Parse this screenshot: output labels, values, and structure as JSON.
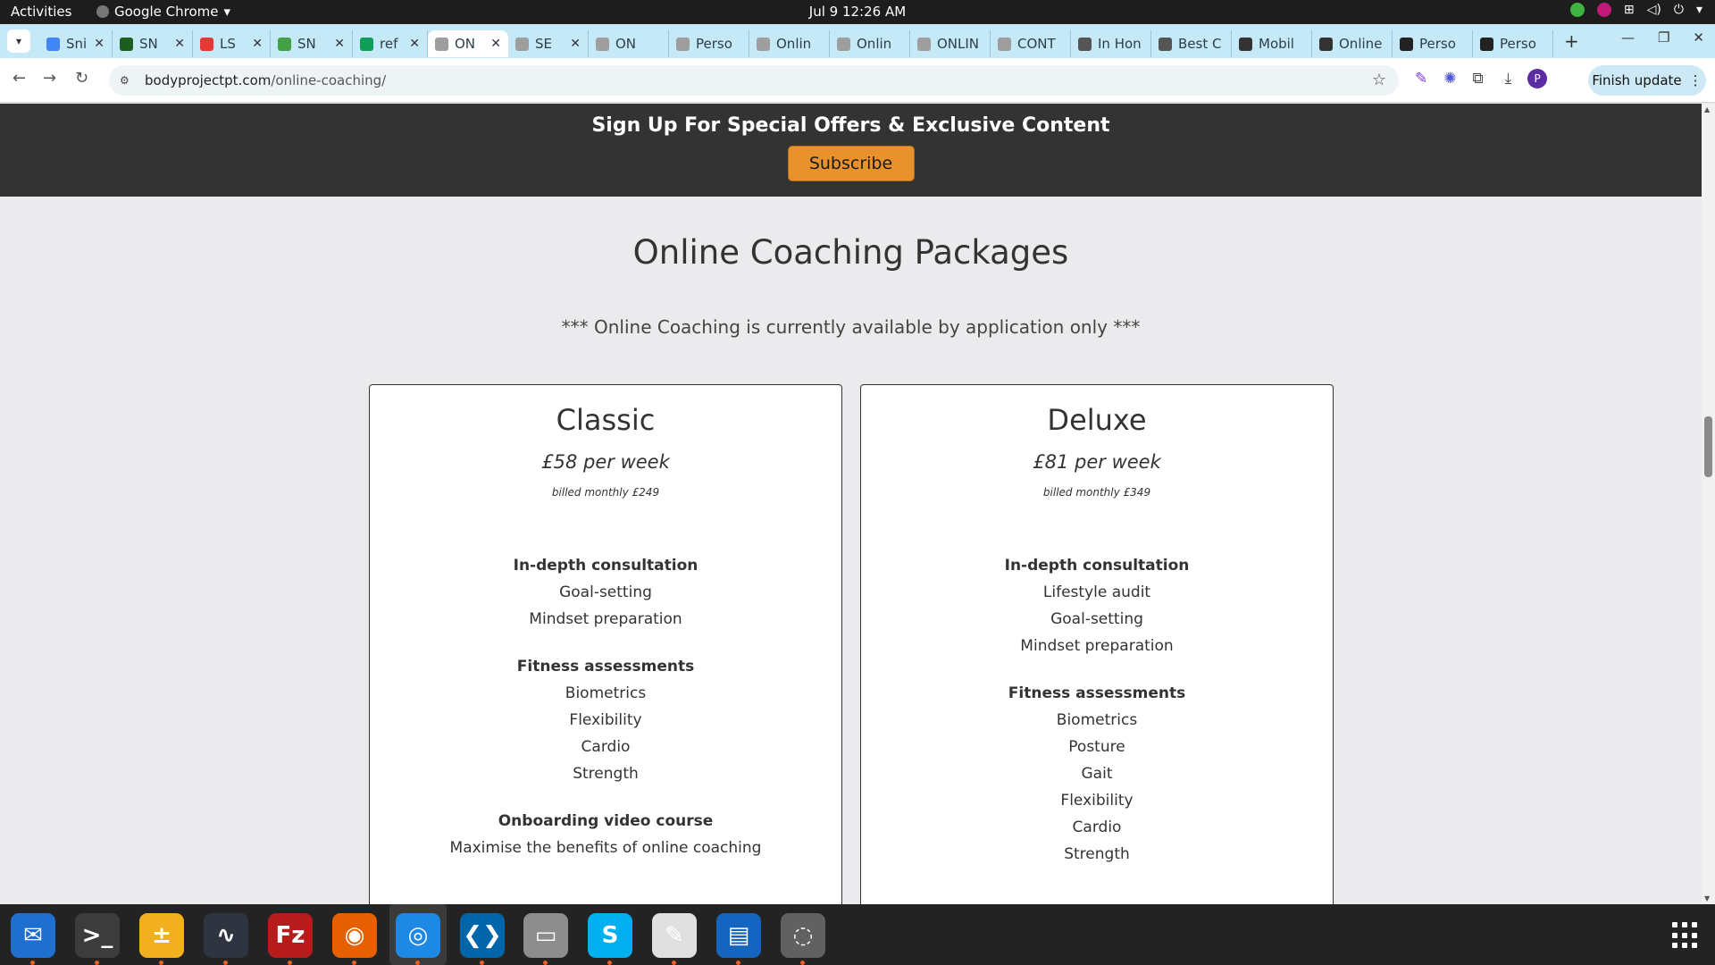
{
  "system": {
    "activities": "Activities",
    "app_name": "Google Chrome",
    "clock": "Jul 9  12:26 AM"
  },
  "tabs": [
    {
      "label": "Sni",
      "color": "#4285f4"
    },
    {
      "label": "SN",
      "color": "#1b5e20"
    },
    {
      "label": "LS",
      "color": "#e53935"
    },
    {
      "label": "SN",
      "color": "#43a047"
    },
    {
      "label": "ref",
      "color": "#0f9d58"
    },
    {
      "label": "ON",
      "color": "#9e9e9e"
    },
    {
      "label": "SE",
      "color": "#9e9e9e"
    },
    {
      "label": "ON",
      "color": "#9e9e9e"
    },
    {
      "label": "Perso",
      "color": "#9e9e9e"
    },
    {
      "label": "Onlin",
      "color": "#9e9e9e"
    },
    {
      "label": "Onlin",
      "color": "#9e9e9e"
    },
    {
      "label": "ONLIN",
      "color": "#9e9e9e"
    },
    {
      "label": "CONT",
      "color": "#9e9e9e"
    },
    {
      "label": "In Hon",
      "color": "#555555"
    },
    {
      "label": "Best C",
      "color": "#555555"
    },
    {
      "label": "Mobil",
      "color": "#333333"
    },
    {
      "label": "Online",
      "color": "#333333"
    },
    {
      "label": "Perso",
      "color": "#222222"
    },
    {
      "label": "Perso",
      "color": "#222222"
    }
  ],
  "toolbar": {
    "url_domain": "bodyprojectpt.com",
    "url_path": "/online-coaching/",
    "profile_letter": "P",
    "finish_update": "Finish update"
  },
  "page": {
    "signup_heading": "Sign Up For Special Offers & Exclusive Content",
    "subscribe_label": "Subscribe",
    "packages_title": "Online Coaching Packages",
    "availability_note": "*** Online Coaching is currently available by application only ***",
    "packages": [
      {
        "name": "Classic",
        "price": "£58 per week",
        "billed": "billed monthly £249",
        "groups": [
          {
            "heading": "In-depth consultation",
            "items": [
              "Goal-setting",
              "Mindset preparation"
            ]
          },
          {
            "heading": "Fitness assessments",
            "items": [
              "Biometrics",
              "Flexibility",
              "Cardio",
              "Strength"
            ]
          },
          {
            "heading": "Onboarding video course",
            "items": [
              "Maximise the benefits of online coaching"
            ]
          }
        ]
      },
      {
        "name": "Deluxe",
        "price": "£81 per week",
        "billed": "billed monthly £349",
        "groups": [
          {
            "heading": "In-depth consultation",
            "items": [
              "Lifestyle audit",
              "Goal-setting",
              "Mindset preparation"
            ]
          },
          {
            "heading": "Fitness assessments",
            "items": [
              "Biometrics",
              "Posture",
              "Gait",
              "Flexibility",
              "Cardio",
              "Strength"
            ]
          }
        ]
      }
    ]
  },
  "dock": [
    {
      "icon": "thunderbird-icon",
      "color": "#1f6fd1",
      "glyph": "✉"
    },
    {
      "icon": "terminal-icon",
      "color": "#3c3c3c",
      "glyph": ">_"
    },
    {
      "icon": "calculator-icon",
      "color": "#f2b01e",
      "glyph": "±"
    },
    {
      "icon": "system-monitor-icon",
      "color": "#2e3440",
      "glyph": "∿"
    },
    {
      "icon": "filezilla-icon",
      "color": "#b71c1c",
      "glyph": "Fz"
    },
    {
      "icon": "firefox-icon",
      "color": "#e66000",
      "glyph": "◉"
    },
    {
      "icon": "chrome-icon",
      "color": "#1e88e5",
      "glyph": "◎"
    },
    {
      "icon": "vscode-icon",
      "color": "#0065a9",
      "glyph": "❮❯"
    },
    {
      "icon": "files-icon",
      "color": "#8d8d8d",
      "glyph": "▭"
    },
    {
      "icon": "skype-icon",
      "color": "#00aff0",
      "glyph": "S"
    },
    {
      "icon": "text-editor-icon",
      "color": "#e0e0e0",
      "glyph": "✎"
    },
    {
      "icon": "libreoffice-writer-icon",
      "color": "#1565c0",
      "glyph": "▤"
    },
    {
      "icon": "disk-icon",
      "color": "#616161",
      "glyph": "◌"
    }
  ]
}
